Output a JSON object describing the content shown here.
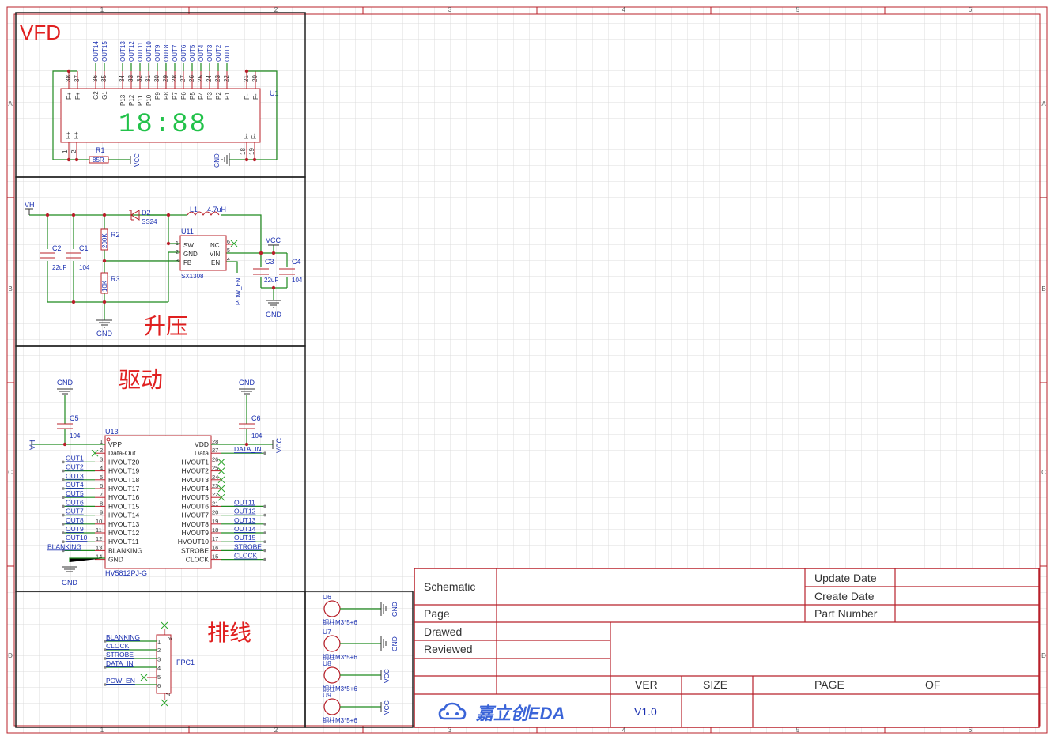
{
  "sheet": {
    "col_markers": [
      "1",
      "2",
      "3",
      "4",
      "5",
      "6"
    ],
    "row_markers": [
      "A",
      "B",
      "C",
      "D"
    ]
  },
  "titles": {
    "vfd": "VFD",
    "boost": "升压",
    "driver": "驱动",
    "cable": "排线"
  },
  "vfd": {
    "ref": "U1",
    "clock_display": "18:88",
    "top_pins": [
      "38",
      "37",
      "36",
      "35",
      "34",
      "33",
      "32",
      "31",
      "30",
      "29",
      "28",
      "27",
      "26",
      "25",
      "24",
      "23",
      "22",
      "21",
      "20"
    ],
    "top_pin_names": [
      "F+",
      "F+",
      "G2",
      "G1",
      "P13",
      "P12",
      "P11",
      "P10",
      "P9",
      "P8",
      "P7",
      "P6",
      "P5",
      "P4",
      "P3",
      "P2",
      "P1",
      "F-",
      "F-"
    ],
    "out_labels": [
      "OUT14",
      "OUT15",
      "OUT13",
      "OUT12",
      "OUT11",
      "OUT10",
      "OUT9",
      "OUT8",
      "OUT7",
      "OUT6",
      "OUT5",
      "OUT4",
      "OUT3",
      "OUT2",
      "OUT1"
    ],
    "bottom_pin_names": [
      "F+",
      "F+",
      "F-",
      "F-"
    ],
    "bottom_pins": [
      "1",
      "2",
      "18",
      "19"
    ],
    "r1_ref": "R1",
    "r1_value": "85R",
    "vcc": "VCC",
    "gnd": "GND"
  },
  "boost": {
    "vh": "VH",
    "d2_ref": "D2",
    "d2_value": "SS24",
    "l1_ref": "L1",
    "l1_value": "4.7uH",
    "r2_ref": "R2",
    "r2_value": "200K",
    "r3_ref": "R3",
    "r3_value": "10K",
    "c2_ref": "C2",
    "c2_value": "22uF",
    "c1_ref": "C1",
    "c1_value": "104",
    "u11_ref": "U11",
    "u11_part": "SX1308",
    "u11_pins_left": [
      "SW",
      "GND",
      "FB"
    ],
    "u11_pins_right": [
      "NC",
      "VIN",
      "EN"
    ],
    "u11_pin_nums_left": [
      "1",
      "2",
      "3"
    ],
    "u11_pin_nums_right": [
      "6",
      "5",
      "4"
    ],
    "c3_ref": "C3",
    "c3_value": "22uF",
    "c4_ref": "C4",
    "c4_value": "104",
    "vcc": "VCC",
    "gnd": "GND",
    "pow_en": "POW_EN"
  },
  "driver": {
    "u13_ref": "U13",
    "u13_part": "HV5812PJ-G",
    "c5_ref": "C5",
    "c5_value": "104",
    "c6_ref": "C6",
    "c6_value": "104",
    "gnd": "GND",
    "vh": "VH",
    "vcc": "VCC",
    "left_pins": [
      "VPP",
      "Data-Out",
      "HVOUT20",
      "HVOUT19",
      "HVOUT18",
      "HVOUT17",
      "HVOUT16",
      "HVOUT15",
      "HVOUT14",
      "HVOUT13",
      "HVOUT12",
      "HVOUT11",
      "BLANKING",
      "GND"
    ],
    "left_nums": [
      "1",
      "2",
      "3",
      "4",
      "5",
      "6",
      "7",
      "8",
      "9",
      "10",
      "11",
      "12",
      "13",
      "14"
    ],
    "right_pins": [
      "VDD",
      "Data",
      "HVOUT1",
      "HVOUT2",
      "HVOUT3",
      "HVOUT4",
      "HVOUT5",
      "HVOUT6",
      "HVOUT7",
      "HVOUT8",
      "HVOUT9",
      "HVOUT10",
      "STROBE",
      "CLOCK"
    ],
    "right_nums": [
      "28",
      "27",
      "26",
      "25",
      "24",
      "23",
      "22",
      "21",
      "20",
      "19",
      "18",
      "17",
      "16",
      "15"
    ],
    "left_nets": [
      "OUT1",
      "OUT2",
      "OUT3",
      "OUT4",
      "OUT5",
      "OUT6",
      "OUT7",
      "OUT8",
      "OUT9",
      "OUT10",
      "BLANKING"
    ],
    "right_nets": [
      "DATA_IN",
      "OUT11",
      "OUT12",
      "OUT13",
      "OUT14",
      "OUT15",
      "STROBE",
      "CLOCK"
    ]
  },
  "cable": {
    "fpc_ref": "FPC1",
    "nets": [
      "BLANKING",
      "CLOCK",
      "STROBE",
      "DATA_IN",
      "POW_EN"
    ],
    "pins": [
      "1",
      "2",
      "3",
      "4",
      "5",
      "6",
      "7",
      "8"
    ]
  },
  "mounts": [
    {
      "ref": "U6",
      "label": "铜柱M3*5+6",
      "net": "GND"
    },
    {
      "ref": "U7",
      "label": "铜柱M3*5+6",
      "net": "GND"
    },
    {
      "ref": "U8",
      "label": "铜柱M3*5+6",
      "net": "VCC"
    },
    {
      "ref": "U9",
      "label": "铜柱M3*5+6",
      "net": "VCC"
    }
  ],
  "title_block": {
    "schematic": "Schematic",
    "page": "Page",
    "drawed": "Drawed",
    "reviewed": "Reviewed",
    "update_date": "Update Date",
    "create_date": "Create Date",
    "part_number": "Part Number",
    "ver": "VER",
    "size": "SIZE",
    "page_label": "PAGE",
    "of": "OF",
    "ver_value": "V1.0",
    "logo_text": "嘉立创EDA"
  }
}
